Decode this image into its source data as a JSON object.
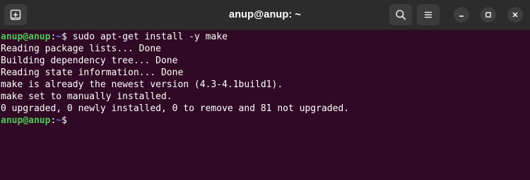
{
  "window": {
    "title": "anup@anup: ~"
  },
  "titlebar": {
    "new_tab_icon": "new-tab-icon",
    "search_icon": "search-icon",
    "menu_icon": "hamburger-menu-icon",
    "minimize_icon": "minimize-icon",
    "maximize_icon": "maximize-icon",
    "close_icon": "close-icon"
  },
  "terminal": {
    "prompt": {
      "user_host": "anup@anup",
      "separator": ":",
      "path": "~",
      "symbol": "$"
    },
    "command": " sudo apt-get install -y make",
    "output": [
      "Reading package lists... Done",
      "Building dependency tree... Done",
      "Reading state information... Done",
      "make is already the newest version (4.3-4.1build1).",
      "make set to manually installed.",
      "0 upgraded, 0 newly installed, 0 to remove and 81 not upgraded."
    ]
  },
  "colors": {
    "background": "#300a24",
    "titlebar": "#2c2c2c",
    "prompt_user": "#4ec959",
    "prompt_path": "#4d7fd6",
    "text": "#ffffff"
  }
}
